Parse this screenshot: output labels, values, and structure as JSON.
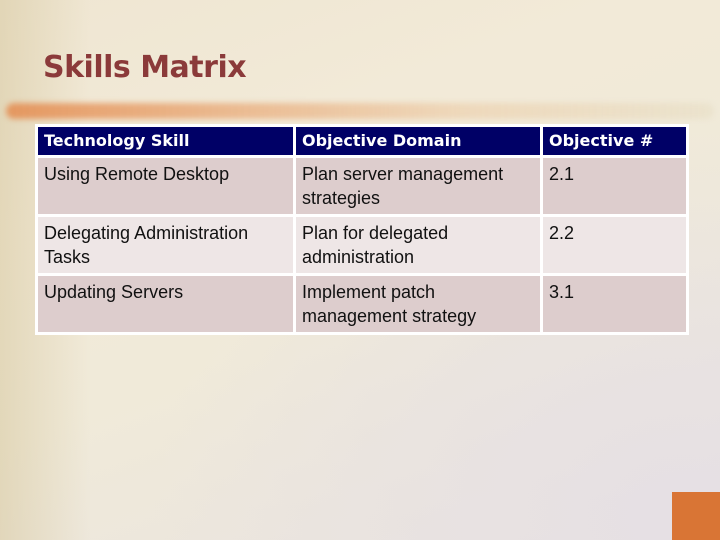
{
  "slide": {
    "title": "Skills Matrix",
    "colors": {
      "title": "#8b3a3a",
      "header_bg": "#000066",
      "row_odd_bg": "#ddcdcd",
      "row_even_bg": "#eee6e6",
      "accent": "#d97535"
    }
  },
  "table": {
    "headers": [
      "Technology Skill",
      "Objective Domain",
      "Objective #"
    ],
    "rows": [
      [
        "Using Remote Desktop",
        "Plan server management strategies",
        "2.1"
      ],
      [
        "Delegating Administration Tasks",
        "Plan for delegated administration",
        "2.2"
      ],
      [
        "Updating Servers",
        "Implement patch management strategy",
        "3.1"
      ]
    ]
  }
}
